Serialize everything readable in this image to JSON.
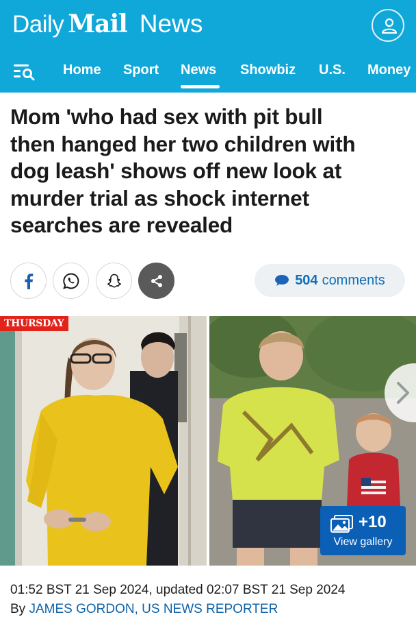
{
  "header": {
    "brand_daily": "Daily",
    "brand_mail": "Mail",
    "section": "News",
    "account_icon": "user-icon",
    "menu_icon": "menu-search-icon"
  },
  "nav": {
    "items": [
      {
        "label": "Home",
        "active": false
      },
      {
        "label": "Sport",
        "active": false
      },
      {
        "label": "News",
        "active": true
      },
      {
        "label": "Showbiz",
        "active": false
      },
      {
        "label": "U.S.",
        "active": false
      },
      {
        "label": "Money",
        "active": false
      }
    ]
  },
  "article": {
    "headline_lines": [
      "Mom 'who had sex with pit bull",
      "then hanged her two children with",
      "dog leash' shows off new look at",
      "murder trial as shock internet",
      "searches are revealed"
    ],
    "comments_count": "504",
    "comments_label": "comments",
    "photo_tag": "THURSDAY",
    "gallery_count": "+10",
    "gallery_label": "View gallery",
    "dateline": "01:52 BST 21 Sep 2024, updated 02:07 BST 21 Sep 2024",
    "byline_prefix": "By",
    "author": "JAMES GORDON, US NEWS REPORTER"
  },
  "share": [
    {
      "icon": "facebook-icon"
    },
    {
      "icon": "whatsapp-icon"
    },
    {
      "icon": "snapchat-icon"
    },
    {
      "icon": "share-icon"
    }
  ],
  "colors": {
    "brand_blue": "#10a7d9",
    "link_blue": "#0e63a8",
    "gallery_blue": "#0b5fb5",
    "tag_red": "#e2231a"
  }
}
